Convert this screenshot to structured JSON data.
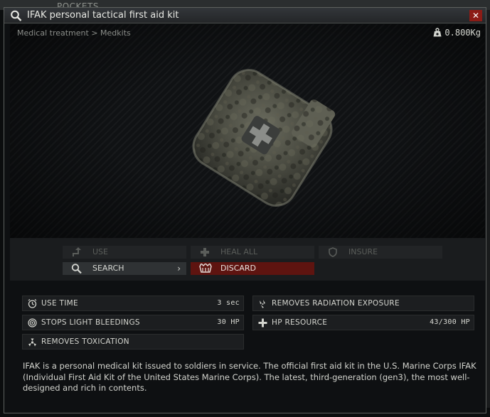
{
  "background": {
    "tab_label": "POCKETS"
  },
  "window": {
    "title": "IFAK personal tactical first aid kit",
    "close_label": "✕"
  },
  "preview": {
    "breadcrumb": "Medical treatment > Medkits",
    "weight": "0.800Kg"
  },
  "actions": {
    "use": "USE",
    "heal_all": "HEAL ALL",
    "insure": "INSURE",
    "search": "SEARCH",
    "search_chevron": "›",
    "discard": "DISCARD"
  },
  "stats": {
    "use_time_label": "USE TIME",
    "use_time_value": "3 sec",
    "stops_bleedings_label": "STOPS LIGHT BLEEDINGS",
    "stops_bleedings_value": "30 HP",
    "removes_toxication_label": "REMOVES TOXICATION",
    "removes_radiation_label": "REMOVES RADIATION EXPOSURE",
    "hp_resource_label": "HP RESOURCE",
    "hp_resource_value": "43/300 HP"
  },
  "description": "IFAK is a personal medical kit issued to soldiers in service. The official first aid kit in the U.S. Marine Corps IFAK (Individual First Aid Kit of the United States Marine Corps). The latest, third-generation (gen3), the most well-designed and rich in contents.",
  "colors": {
    "discard_red": "#5e1410",
    "close_red": "#8c1c16",
    "panel_bg": "#0e1012"
  },
  "icons": [
    "search-icon",
    "close-icon",
    "weight-icon",
    "use-icon",
    "heal-icon",
    "insure-icon",
    "discard-icon",
    "timer-icon",
    "bleeding-icon",
    "toxin-icon",
    "radiation-icon",
    "hp-icon"
  ]
}
